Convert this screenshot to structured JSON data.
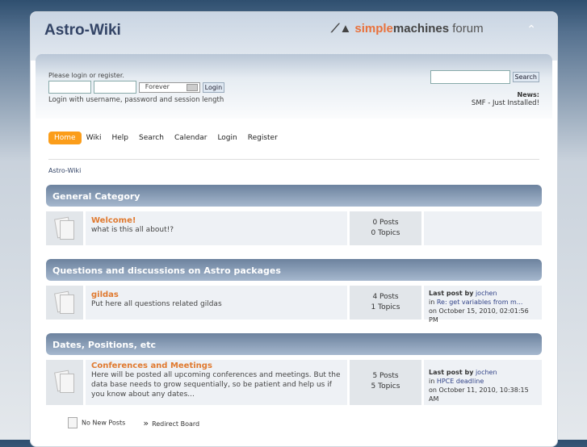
{
  "header": {
    "title": "Astro-Wiki",
    "logo": {
      "simple": "simple",
      "machines": "machines",
      "forum": "forum"
    }
  },
  "user": {
    "prompt": "Please login or register.",
    "session": "Forever",
    "login": "Login",
    "hint": "Login with username, password and session length"
  },
  "search": {
    "button": "Search"
  },
  "news": {
    "label": "News:",
    "text": "SMF - Just Installed!"
  },
  "nav": [
    "Home",
    "Wiki",
    "Help",
    "Search",
    "Calendar",
    "Login",
    "Register"
  ],
  "breadcrumb": "Astro-Wiki",
  "categories": [
    {
      "title": "General Category",
      "board": {
        "name": "Welcome!",
        "desc": "what is this all about!?",
        "posts": "0 Posts",
        "topics": "0 Topics"
      }
    },
    {
      "title": "Questions and discussions on Astro packages",
      "board": {
        "name": "gildas",
        "desc": "Put here all questions related gildas",
        "posts": "4 Posts",
        "topics": "1 Topics",
        "last1": "Last post by",
        "by": "jochen",
        "in": "in",
        "topic": "Re: get variables from m...",
        "date": "on October 15, 2010, 02:01:56 PM"
      }
    },
    {
      "title": "Dates, Positions, etc",
      "board": {
        "name": "Conferences and Meetings",
        "desc": "Here will be posted all upcoming conferences and meetings. But the data base needs to grow sequentially, so be patient and help us if you know about any dates...",
        "posts": "5 Posts",
        "topics": "5 Topics",
        "last1": "Last post by",
        "by": "jochen",
        "in": "in",
        "topic": "HPCE deadline",
        "date": "on October 11, 2010, 10:38:15 AM"
      }
    }
  ],
  "legend": {
    "no_new": "No New Posts",
    "redirect": "Redirect Board"
  }
}
